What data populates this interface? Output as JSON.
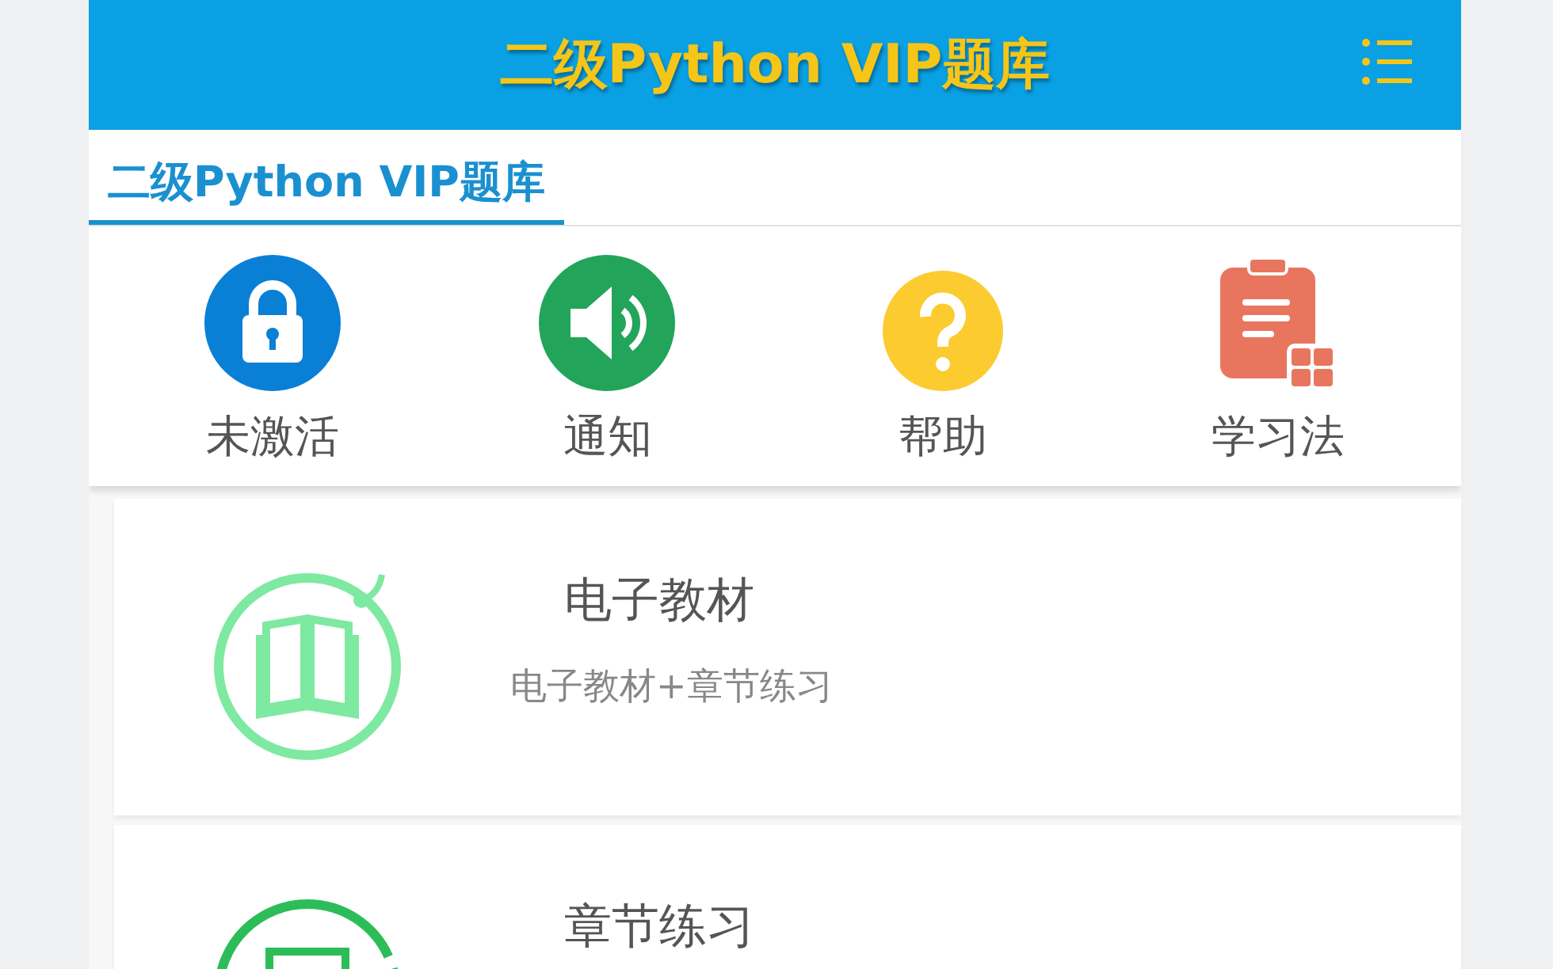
{
  "header": {
    "title": "二级Python VIP题库"
  },
  "tabs": [
    {
      "label": "二级Python VIP题库",
      "selected": true
    }
  ],
  "shortcuts": [
    {
      "kind": "lock",
      "label": "未激活"
    },
    {
      "kind": "speaker",
      "label": "通知"
    },
    {
      "kind": "question",
      "label": "帮助"
    },
    {
      "kind": "clipboard",
      "label": "学习法"
    }
  ],
  "modules": [
    {
      "kind": "book",
      "title": "电子教材",
      "subtitle": "电子教材+章节练习"
    },
    {
      "kind": "document",
      "title": "章节练习"
    }
  ]
}
